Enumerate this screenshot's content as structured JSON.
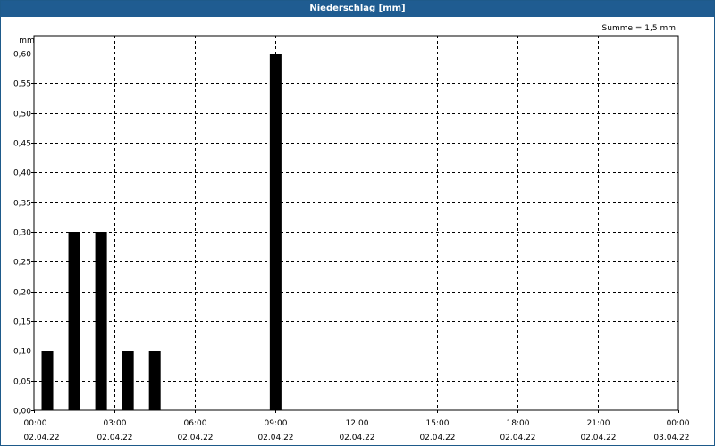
{
  "window": {
    "title": "Niederschlag [mm]"
  },
  "chart_data": {
    "type": "bar",
    "title": "Niederschlag [mm]",
    "ylabel": "mm",
    "annotation": "Summe = 1,5 mm",
    "ylim": [
      0,
      0.6
    ],
    "xlim_hours": [
      0,
      24
    ],
    "grid": true,
    "bar_color": "#000000",
    "bar_width_hours": 0.5,
    "y_ticks": [
      "0,00",
      "0,05",
      "0,10",
      "0,15",
      "0,20",
      "0,25",
      "0,30",
      "0,35",
      "0,40",
      "0,45",
      "0,50",
      "0,55",
      "0,60"
    ],
    "x_ticks": [
      {
        "time": "00:00",
        "date": "02.04.22"
      },
      {
        "time": "03:00",
        "date": "02.04.22"
      },
      {
        "time": "06:00",
        "date": "02.04.22"
      },
      {
        "time": "09:00",
        "date": "02.04.22"
      },
      {
        "time": "12:00",
        "date": "02.04.22"
      },
      {
        "time": "15:00",
        "date": "02.04.22"
      },
      {
        "time": "18:00",
        "date": "02.04.22"
      },
      {
        "time": "21:00",
        "date": "02.04.22"
      },
      {
        "time": "00:00",
        "date": "03.04.22"
      }
    ],
    "series": [
      {
        "x": [
          "00:30",
          "01:30",
          "02:30",
          "03:30",
          "04:30",
          "09:00"
        ],
        "values": [
          0.1,
          0.3,
          0.3,
          0.1,
          0.1,
          0.6
        ]
      }
    ]
  }
}
